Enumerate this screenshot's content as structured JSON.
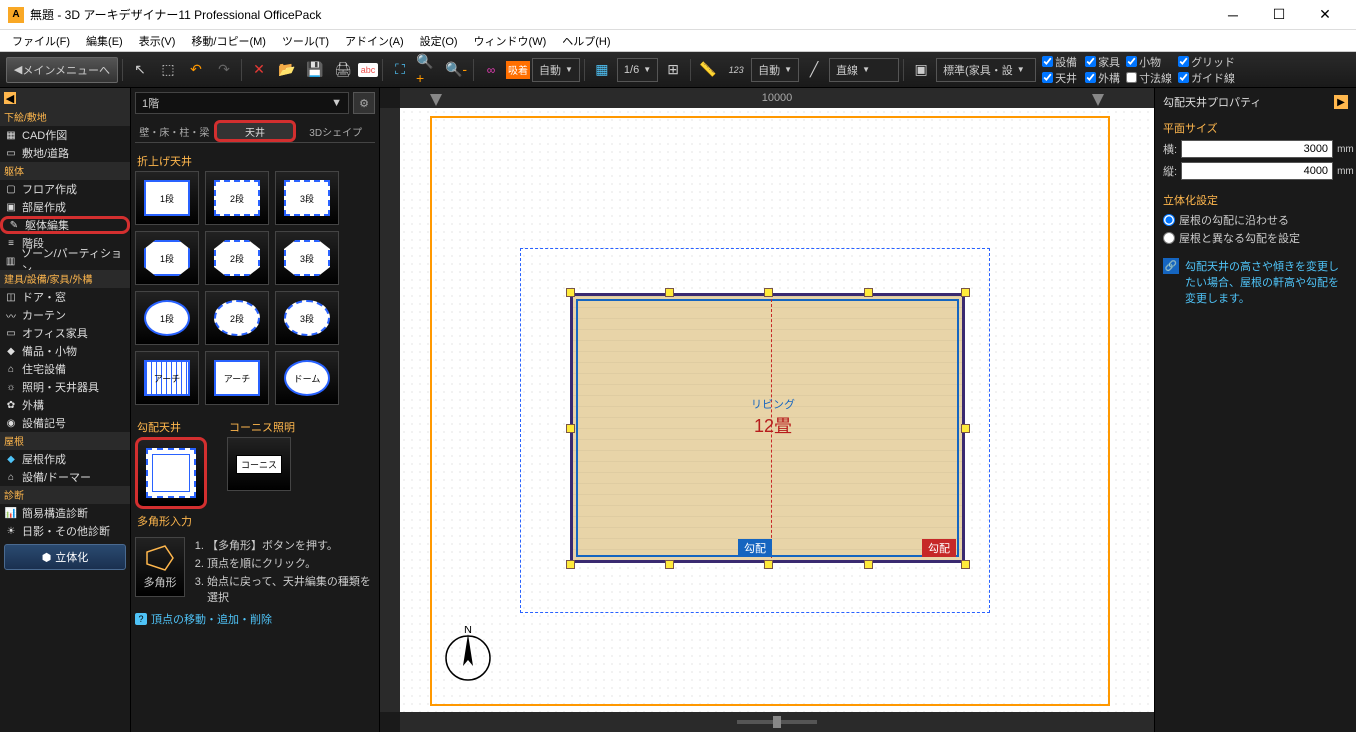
{
  "title": "無題 - 3D アーキデザイナー11 Professional OfficePack",
  "menu": {
    "file": "ファイル(F)",
    "edit": "編集(E)",
    "view": "表示(V)",
    "move": "移動/コピー(M)",
    "tool": "ツール(T)",
    "addin": "アドイン(A)",
    "setting": "設定(O)",
    "window": "ウィンドウ(W)",
    "help": "ヘルプ(H)"
  },
  "toolbar": {
    "back": "メインメニューへ",
    "snap": "吸着",
    "auto1": "自動",
    "grid_ratio": "1/6",
    "auto2": "自動",
    "line": "直線",
    "layer": "標準(家具・設",
    "chk": {
      "setsubi": "設備",
      "kagu": "家具",
      "tenjou": "天井",
      "gaikou": "外構",
      "komono": "小物",
      "sunpo": "寸法線",
      "grid": "グリッド",
      "guide": "ガイド線"
    }
  },
  "ruler_label": "10000",
  "left": {
    "cat_sketch": "下絵/敷地",
    "cad": "CAD作図",
    "shikichi": "敷地/道路",
    "cat_body": "躯体",
    "floor": "フロア作成",
    "heya": "部屋作成",
    "kutai": "躯体編集",
    "kaidan": "階段",
    "zone": "ゾーン/パーティション",
    "cat_parts": "建具/設備/家具/外構",
    "door": "ドア・窓",
    "curtain": "カーテン",
    "office": "オフィス家具",
    "bihin": "備品・小物",
    "jutaku": "住宅設備",
    "shoumei": "照明・天井器具",
    "gaikou": "外構",
    "setsubi": "設備記号",
    "cat_roof": "屋根",
    "yane": "屋根作成",
    "dormer": "設備/ドーマー",
    "cat_diag": "診断",
    "kani": "簡易構造診断",
    "hikage": "日影・その他診断",
    "make3d": "立体化"
  },
  "palette": {
    "floor": "1階",
    "tabs": {
      "wall": "壁・床・柱・梁",
      "ceiling": "天井",
      "shape3d": "3Dシェイプ"
    },
    "sec_oriage": "折上げ天井",
    "thumbs_sq": [
      "1段",
      "2段",
      "3段"
    ],
    "thumbs_oct": [
      "1段",
      "2段",
      "3段"
    ],
    "thumbs_circ": [
      "1段",
      "2段",
      "3段"
    ],
    "thumbs_arch": [
      "アーチ",
      "アーチ",
      "ドーム"
    ],
    "sec_koubai": "勾配天井",
    "sec_cornice": "コーニス照明",
    "cornice_label": "コーニス",
    "sec_poly": "多角形入力",
    "poly_btn": "多角形",
    "poly_hints": [
      "【多角形】ボタンを押す。",
      "頂点を順にクリック。",
      "始点に戻って、天井編集の種類を選択"
    ],
    "help": "頂点の移動・追加・削除"
  },
  "canvas": {
    "room_name": "リビング",
    "room_size": "12畳",
    "tag1": "勾配",
    "tag2": "勾配"
  },
  "props": {
    "title": "勾配天井プロパティ",
    "sec_size": "平面サイズ",
    "w_label": "横:",
    "w_val": "3000",
    "h_label": "縦:",
    "h_val": "4000",
    "unit": "mm",
    "sec_3d": "立体化設定",
    "radio1": "屋根の勾配に沿わせる",
    "radio2": "屋根と異なる勾配を設定",
    "hint": "勾配天井の高さや傾きを変更したい場合、屋根の軒高や勾配を変更します。"
  }
}
